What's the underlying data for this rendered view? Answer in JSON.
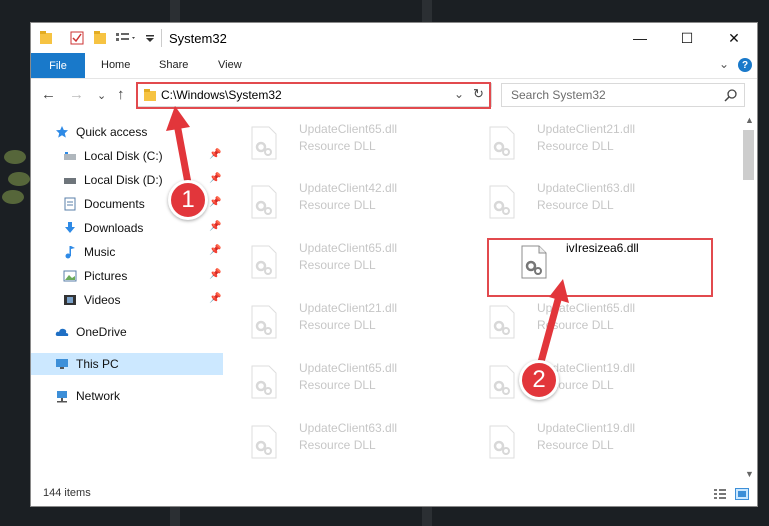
{
  "window": {
    "title": "System32",
    "controls": {
      "minimize": "—",
      "maximize": "☐",
      "close": "✕"
    }
  },
  "ribbon": {
    "file_tab": "File",
    "tabs": [
      "Home",
      "Share",
      "View"
    ],
    "chevron": "⌄",
    "help": "?"
  },
  "nav": {
    "back": "←",
    "forward": "→",
    "recent": "⌄",
    "up": "↑",
    "address": "C:\\Windows\\System32",
    "address_dropdown": "⌄",
    "refresh": "↻",
    "search_placeholder": "Search System32"
  },
  "sidebar": {
    "items": [
      {
        "label": "Quick access",
        "icon": "star-icon"
      },
      {
        "label": "Local Disk (C:)",
        "icon": "drive-icon",
        "pinned": true
      },
      {
        "label": "Local Disk (D:)",
        "icon": "drive-icon",
        "pinned": true
      },
      {
        "label": "Documents",
        "icon": "document-icon",
        "pinned": true
      },
      {
        "label": "Downloads",
        "icon": "download-icon",
        "pinned": true
      },
      {
        "label": "Music",
        "icon": "music-icon",
        "pinned": true
      },
      {
        "label": "Pictures",
        "icon": "picture-icon",
        "pinned": true
      },
      {
        "label": "Videos",
        "icon": "video-icon",
        "pinned": true
      },
      {
        "label": "OneDrive",
        "icon": "cloud-icon"
      },
      {
        "label": "This PC",
        "icon": "computer-icon",
        "selected": true
      },
      {
        "label": "Network",
        "icon": "network-icon"
      }
    ]
  },
  "files": [
    {
      "name": "UpdateClient65.dll",
      "type": "Resource DLL",
      "faded": true
    },
    {
      "name": "UpdateClient21.dll",
      "type": "Resource DLL",
      "faded": true
    },
    {
      "name": "UpdateClient42.dll",
      "type": "Resource DLL",
      "faded": true
    },
    {
      "name": "UpdateClient63.dll",
      "type": "Resource DLL",
      "faded": true
    },
    {
      "name": "UpdateClient65.dll",
      "type": "Resource DLL",
      "faded": true
    },
    {
      "name": "ivIresizea6.dll",
      "type": "",
      "faded": false
    },
    {
      "name": "UpdateClient21.dll",
      "type": "Resource DLL",
      "faded": true
    },
    {
      "name": "UpdateClient65.dll",
      "type": "Resource DLL",
      "faded": true
    },
    {
      "name": "UpdateClient65.dll",
      "type": "Resource DLL",
      "faded": true
    },
    {
      "name": "UpdateClient19.dll",
      "type": "Resource DLL",
      "faded": true
    },
    {
      "name": "UpdateClient63.dll",
      "type": "Resource DLL",
      "faded": true
    },
    {
      "name": "UpdateClient19.dll",
      "type": "Resource DLL",
      "faded": true
    }
  ],
  "status": {
    "item_count": "144 items"
  },
  "annotations": {
    "step1": "1",
    "step2": "2",
    "color": "#e2363b"
  },
  "colors": {
    "accent": "#1979ca",
    "selected_bg": "#cce8ff",
    "highlight": "#e24a4e"
  }
}
